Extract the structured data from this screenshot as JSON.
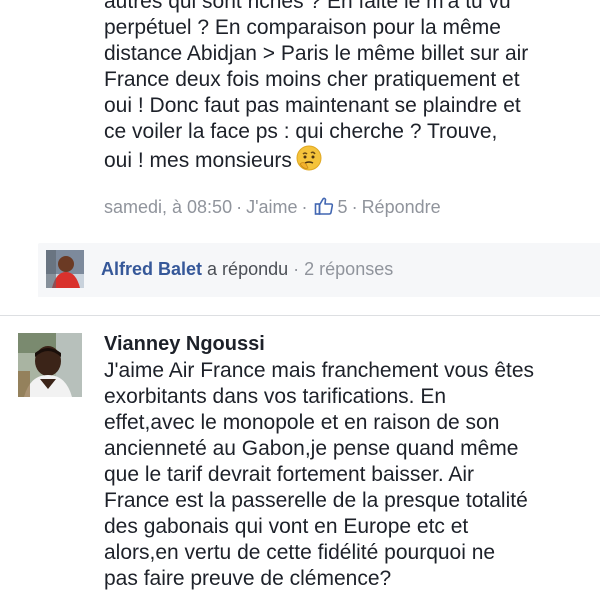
{
  "comment_1": {
    "text": "autres qui sont riches ? En faite le m'a tu vu\nperpétuel ? En comparaison pour la même\ndistance Abidjan > Paris le même billet sur air\nFrance deux fois moins cher pratiquement et\noui ! Donc faut pas maintenant se plaindre et\nce voiler la face ps : qui cherche ? Trouve,\noui ! mes monsieurs",
    "emoji": "thinking-face",
    "timestamp": "samedi, à 08:50",
    "like_label": "J'aime",
    "like_count": "5",
    "reply_label": "Répondre",
    "separator": "·"
  },
  "replies_preview": {
    "name": "Alfred Balet",
    "action": "a répondu",
    "separator": "·",
    "count": "2 réponses"
  },
  "comment_2": {
    "author": "Vianney Ngoussi",
    "text": "J'aime Air France mais franchement vous êtes\nexorbitants dans vos tarifications. En\neffet,avec le monopole et en raison de son\nancienneté au Gabon,je pense quand même\nque le tarif devrait fortement baisser. Air\nFrance est la passerelle de la presque totalité\ndes gabonais qui vont en Europe etc et\nalors,en vertu de cette fidélité pourquoi ne\npas faire preuve de clémence?"
  },
  "colors": {
    "link": "#365899",
    "meta": "#90949c",
    "like_blue": "#4267b2",
    "reply_bg": "#f6f7f9"
  }
}
